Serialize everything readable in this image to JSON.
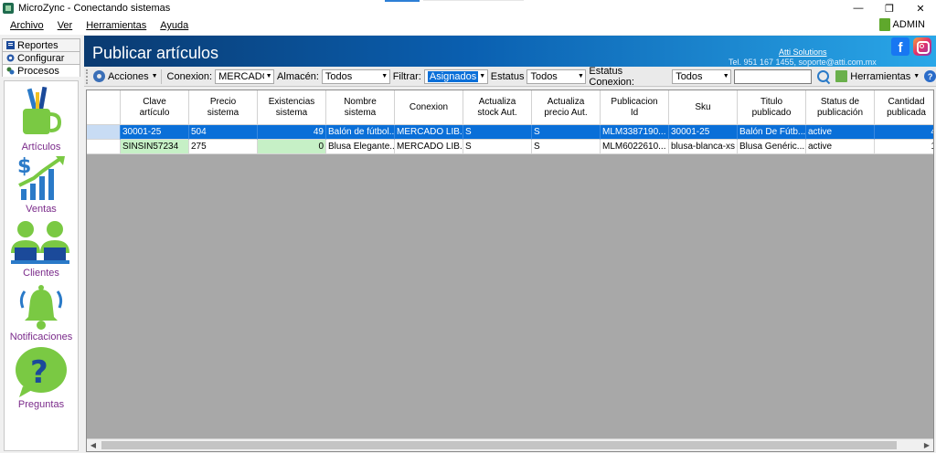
{
  "window": {
    "title": "MicroZync - Conectando sistemas",
    "min": "—",
    "restore": "❐",
    "close": "✕"
  },
  "menu": {
    "items": [
      "Archivo",
      "Ver",
      "Herramientas",
      "Ayuda"
    ],
    "user": "ADMIN"
  },
  "nav": {
    "tabs": [
      "Reportes",
      "Configurar",
      "Procesos"
    ],
    "items": [
      "Artículos",
      "Ventas",
      "Clientes",
      "Notificaciones",
      "Preguntas"
    ]
  },
  "header": {
    "title": "Publicar artículos",
    "company": "Atti Solutions",
    "contact": "Tel. 951 167 1455, soporte@atti.com.mx",
    "facebook": "f"
  },
  "toolbar": {
    "actions": "Acciones",
    "conexion_label": "Conexion:",
    "conexion_value": "MERCADO LIBRE",
    "almacen_label": "Almacén:",
    "almacen_value": "Todos",
    "filtrar_label": "Filtrar:",
    "filtrar_value": "Asignados",
    "estatus_label": "Estatus",
    "estatus_value": "Todos",
    "estatus_conexion_label": "Estatus Conexion:",
    "estatus_conexion_value": "Todos",
    "search_value": "",
    "tools": "Herramientas",
    "help": "?"
  },
  "grid": {
    "columns": [
      "",
      "Clave\nartículo",
      "Precio\nsistema",
      "Existencias\nsistema",
      "Nombre\nsistema",
      "Conexion",
      "Actualiza\nstock Aut.",
      "Actualiza\nprecio Aut.",
      "Publicacion\nId",
      "Sku",
      "Titulo\npublicado",
      "Status de\npublicación",
      "Cantidad\npublicada"
    ],
    "rows": [
      [
        "",
        "30001-25",
        "504",
        "49",
        "Balón de fútbol...",
        "MERCADO LIB...",
        "S",
        "S",
        "MLM3387190...",
        "30001-25",
        "Balón De Fútb...",
        "active",
        "4"
      ],
      [
        "",
        "SINSIN57234",
        "275",
        "0",
        "Blusa Elegante...",
        "MERCADO LIB...",
        "S",
        "S",
        "MLM6022610...",
        "blusa-blanca-xs",
        "Blusa Genéric...",
        "active",
        "1"
      ]
    ]
  },
  "colors": {
    "header_start": "#0a3a70",
    "header_end": "#2aa7e8",
    "selection": "#0a6fd8",
    "green_row": "#c6f0c6",
    "nav_label": "#7a2a8a"
  }
}
